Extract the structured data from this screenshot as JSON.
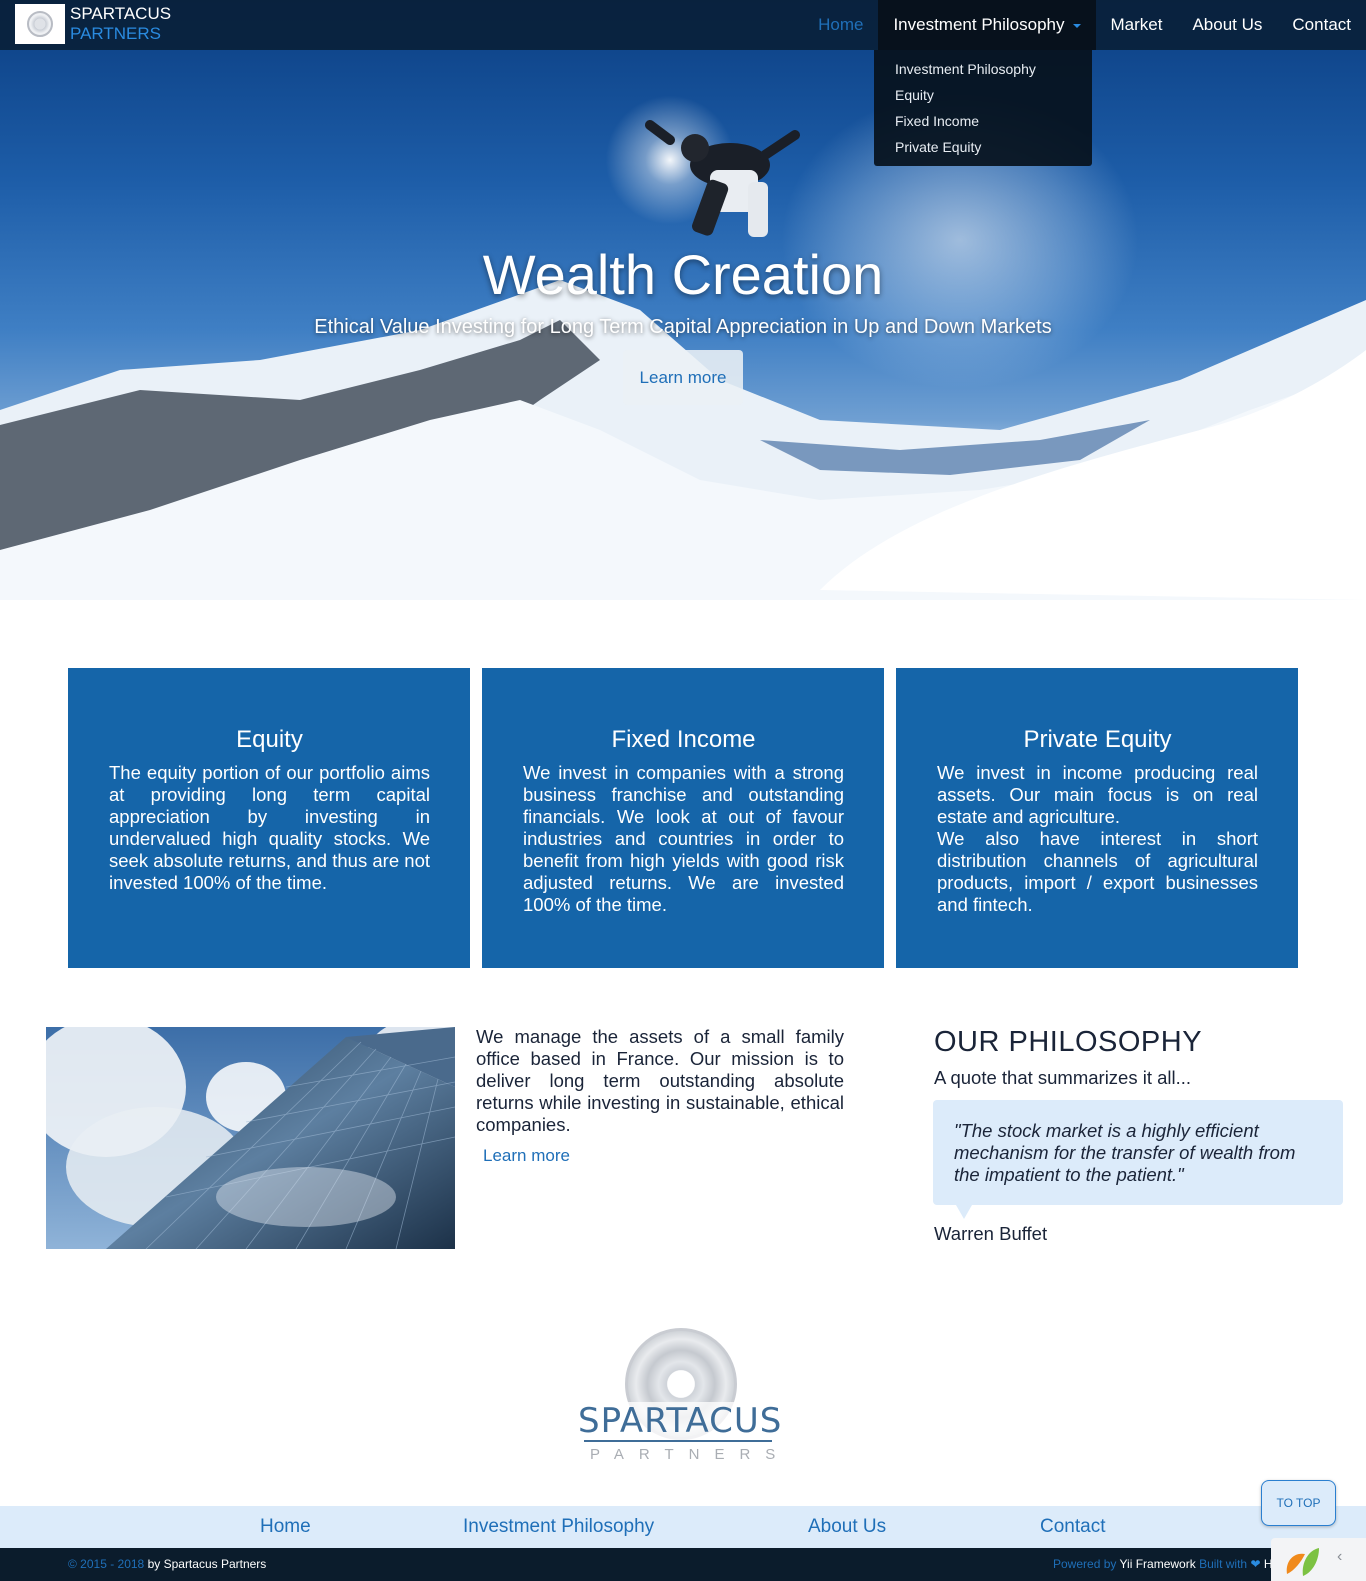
{
  "brand": {
    "line1": "SPARTACUS",
    "line2": "PARTNERS"
  },
  "nav": {
    "items": [
      "Home",
      "Investment Philosophy",
      "Market",
      "About Us",
      "Contact"
    ],
    "dropdown": [
      "Investment Philosophy",
      "Equity",
      "Fixed Income",
      "Private Equity"
    ]
  },
  "hero": {
    "title": "Wealth Creation",
    "subtitle": "Ethical Value Investing for Long Term Capital Appreciation in Up and Down Markets",
    "button": "Learn more"
  },
  "cards": [
    {
      "title": "Equity",
      "text": "The equity portion of our portfolio aims at providing long term capital appreciation by investing in undervalued high quality stocks. We seek absolute returns, and thus are not invested 100% of the time."
    },
    {
      "title": "Fixed Income",
      "text": "We invest in companies with a strong business franchise and outstanding financials. We look at out of favour industries and countries in order to benefit from high yields with good risk adjusted returns. We are invested 100% of the time."
    },
    {
      "title": "Private Equity",
      "text": "We invest in income producing real assets. Our main focus is on real estate and agriculture.",
      "text2": "We also have interest in short distribution channels of agricultural products, import / export businesses and fintech."
    }
  ],
  "about": {
    "text": "We manage the assets of a small family office based in France. Our mission is to deliver long term outstanding absolute returns while investing in sustainable, ethical companies.",
    "link": "Learn more"
  },
  "philosophy": {
    "heading": "OUR PHILOSOPHY",
    "sub": "A quote that summarizes it all...",
    "quote": "\"The stock market is a highly efficient mechanism for the transfer of wealth from the impatient to the patient.\"",
    "author": "Warren Buffet"
  },
  "logo": {
    "name": "SPARTACUS",
    "sub": "PARTNERS"
  },
  "footer_nav": [
    "Home",
    "Investment Philosophy",
    "About Us",
    "Contact"
  ],
  "to_top": "TO TOP",
  "bottom": {
    "copy_years": "© 2015 - 2018",
    "copy_by": "by Spartacus Partners",
    "powered_label": "Powered by",
    "powered_name": "Yii Framework",
    "built_label": "Built with",
    "built_tail": "H"
  },
  "colors": {
    "accent": "#1565a9",
    "link": "#1f6fb8",
    "light": "#dcebfa",
    "dark": "#0b1c2c"
  }
}
